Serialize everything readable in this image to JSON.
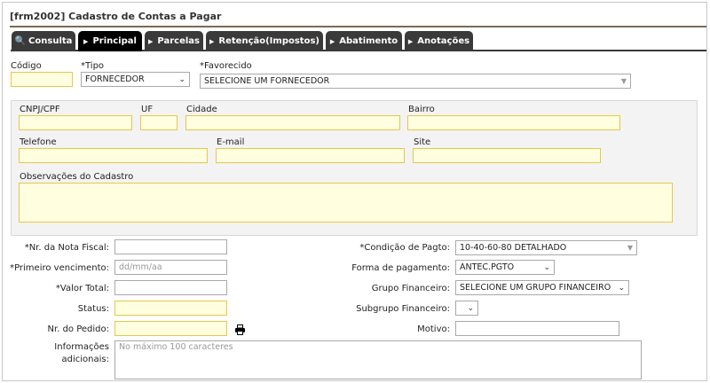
{
  "title": "[frm2002] Cadastro de Contas a Pagar",
  "tabs": [
    {
      "label": "Consulta"
    },
    {
      "label": "Principal"
    },
    {
      "label": "Parcelas"
    },
    {
      "label": "Retenção(Impostos)"
    },
    {
      "label": "Abatimento"
    },
    {
      "label": "Anotações"
    }
  ],
  "top": {
    "codigo_label": "Código",
    "tipo_label": "*Tipo",
    "tipo_value": "FORNECEDOR",
    "favorecido_label": "*Favorecido",
    "favorecido_value": "SELECIONE UM FORNECEDOR"
  },
  "panel": {
    "cnpj_label": "CNPJ/CPF",
    "uf_label": "UF",
    "cidade_label": "Cidade",
    "bairro_label": "Bairro",
    "telefone_label": "Telefone",
    "email_label": "E-mail",
    "site_label": "Site",
    "observacoes_label": "Observações do Cadastro"
  },
  "left": {
    "nota_fiscal_label": "*Nr. da Nota Fiscal:",
    "primeiro_venc_label": "*Primeiro vencimento:",
    "primeiro_venc_placeholder": "dd/mm/aa",
    "valor_total_label": "*Valor Total:",
    "status_label": "Status:",
    "pedido_label": "Nr. do Pedido:",
    "info_label_1": "Informações",
    "info_label_2": "adicionais:",
    "info_placeholder": "No máximo 100 caracteres"
  },
  "right": {
    "cond_pagto_label": "*Condição de Pagto:",
    "cond_pagto_value": "10-40-60-80 DETALHADO",
    "forma_pagto_label": "Forma de pagamento:",
    "forma_pagto_value": "ANTEC.PGTO",
    "grupo_label": "Grupo Financeiro:",
    "grupo_value": "SELECIONE UM GRUPO FINANCEIRO",
    "subgrupo_label": "Subgrupo Financeiro:",
    "subgrupo_value": "",
    "motivo_label": "Motivo:"
  },
  "icons": {
    "consulta_tab": "magnifier-icon",
    "tab_arrow": "triangle-right-icon",
    "dropdown": "chevron-down-icon",
    "print": "printer-icon"
  }
}
